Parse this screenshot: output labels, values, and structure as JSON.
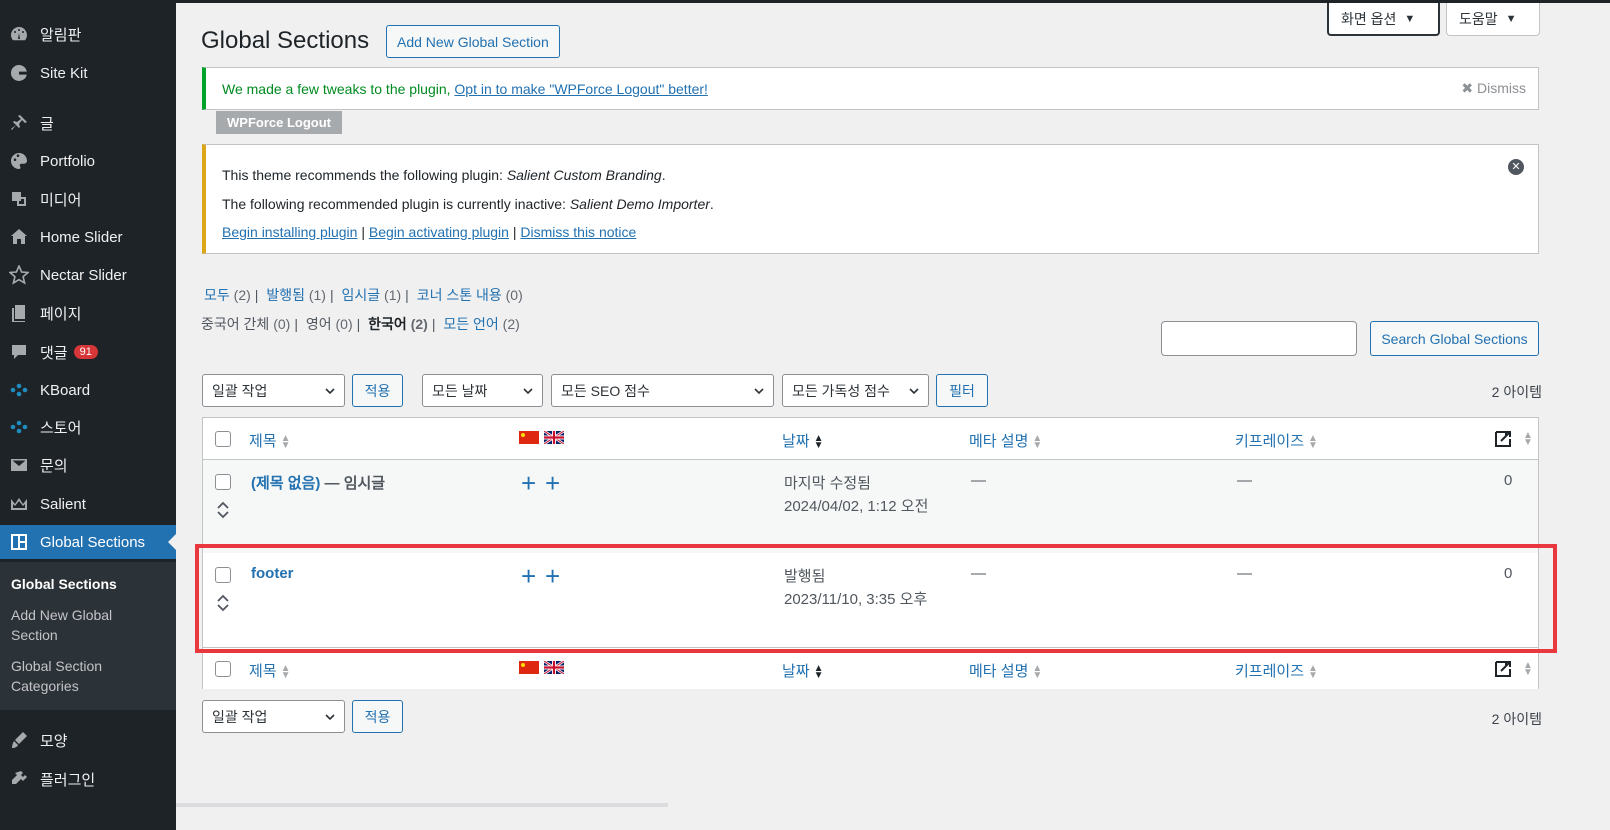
{
  "sidebar": {
    "items": [
      {
        "label": "알림판",
        "icon": "dashboard-icon"
      },
      {
        "label": "Site Kit",
        "icon": "google-icon"
      },
      {
        "label": "글",
        "icon": "pin-icon"
      },
      {
        "label": "Portfolio",
        "icon": "palette-icon"
      },
      {
        "label": "미디어",
        "icon": "media-icon"
      },
      {
        "label": "Home Slider",
        "icon": "home-icon"
      },
      {
        "label": "Nectar Slider",
        "icon": "star-icon"
      },
      {
        "label": "페이지",
        "icon": "page-icon"
      },
      {
        "label": "댓글",
        "icon": "comment-icon",
        "badge": "91"
      },
      {
        "label": "KBoard",
        "icon": "kboard-icon"
      },
      {
        "label": "스토어",
        "icon": "store-icon"
      },
      {
        "label": "문의",
        "icon": "mail-icon"
      },
      {
        "label": "Salient",
        "icon": "crown-icon"
      },
      {
        "label": "Global Sections",
        "icon": "sections-icon",
        "active": true
      },
      {
        "label": "모양",
        "icon": "brush-icon"
      },
      {
        "label": "플러그인",
        "icon": "plugin-icon"
      }
    ],
    "submenu": [
      "Global Sections",
      "Add New Global Section",
      "Global Section Categories"
    ]
  },
  "screen_meta": {
    "screen_options": "화면 옵션",
    "help": "도움말"
  },
  "page": {
    "title": "Global Sections",
    "add_new": "Add New Global Section"
  },
  "notice_green": {
    "text": "We made a few tweaks to the plugin, ",
    "link": "Opt in to make \"WPForce Logout\" better!",
    "dismiss": "Dismiss",
    "tag": "WPForce Logout"
  },
  "notice_yellow": {
    "line1_prefix": "This theme recommends the following plugin: ",
    "line1_plugin": "Salient Custom Branding",
    "line2_prefix": "The following recommended plugin is currently inactive: ",
    "line2_plugin": "Salient Demo Importer",
    "link_install": "Begin installing plugin",
    "link_activate": "Begin activating plugin",
    "link_dismiss": "Dismiss this notice",
    "sep": "|"
  },
  "status_filters": [
    {
      "label": "모두",
      "count": "(2)"
    },
    {
      "label": "발행됨",
      "count": "(1)"
    },
    {
      "label": "임시글",
      "count": "(1)"
    },
    {
      "label": "코너 스톤 내용",
      "count": "(0)"
    }
  ],
  "lang_filters": [
    {
      "label": "중국어 간체",
      "count": "(0)"
    },
    {
      "label": "영어",
      "count": "(0)"
    },
    {
      "label": "한국어",
      "count": "(2)",
      "current": true
    },
    {
      "label": "모든 언어",
      "count": "(2)"
    }
  ],
  "search": {
    "button": "Search Global Sections",
    "value": ""
  },
  "toolbar": {
    "bulk": "일괄 작업",
    "apply": "적용",
    "dates": "모든 날짜",
    "seo": "모든 SEO 점수",
    "readability": "모든 가독성 점수",
    "filter": "필터",
    "count": "2 아이템"
  },
  "table": {
    "columns": {
      "title": "제목",
      "date": "날짜",
      "meta": "메타 설명",
      "keyphrase": "키프레이즈"
    },
    "rows": [
      {
        "title": "(제목 없음)",
        "state": " — 임시글",
        "status": "마지막 수정됨",
        "date": "2024/04/02, 1:12 오전",
        "meta": "—",
        "keyphrase": "—",
        "links": "0"
      },
      {
        "title": "footer",
        "state": "",
        "status": "발행됨",
        "date": "2023/11/10, 3:35 오후",
        "meta": "—",
        "keyphrase": "—",
        "links": "0"
      }
    ]
  },
  "colors": {
    "accent": "#2271b1",
    "sidebar": "#1d2327",
    "highlight": "#e8373f",
    "notice_success": "#00a32a",
    "notice_warning": "#dba617"
  }
}
